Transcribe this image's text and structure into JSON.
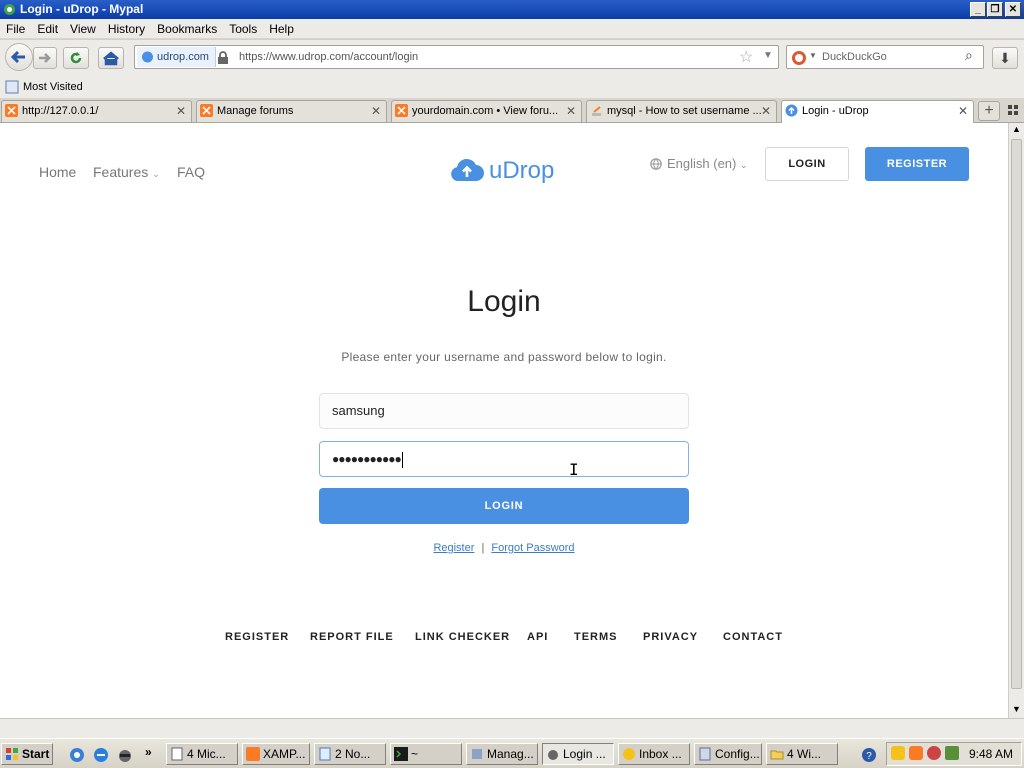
{
  "window": {
    "title": "Login - uDrop - Mypal"
  },
  "menu": [
    "File",
    "Edit",
    "View",
    "History",
    "Bookmarks",
    "Tools",
    "Help"
  ],
  "urlbar": {
    "site": "udrop.com",
    "url": "https://www.udrop.com/account/login"
  },
  "search": {
    "placeholder": "DuckDuckGo"
  },
  "bookmarks": {
    "most_visited": "Most Visited"
  },
  "tabs": [
    {
      "label": "http://127.0.0.1/"
    },
    {
      "label": "Manage forums"
    },
    {
      "label": "yourdomain.com • View foru..."
    },
    {
      "label": "mysql - How to set username ..."
    },
    {
      "label": "Login - uDrop"
    }
  ],
  "page": {
    "nav": {
      "home": "Home",
      "features": "Features",
      "faq": "FAQ"
    },
    "brand": "uDrop",
    "language": "English (en)",
    "header_login": "LOGIN",
    "header_register": "REGISTER",
    "heading": "Login",
    "intro": "Please enter your username and password below to login.",
    "username_value": "samsung",
    "password_value": "●●●●●●●●●●●",
    "login_button": "LOGIN",
    "register_link": "Register",
    "separator": "|",
    "forgot_link": "Forgot Password",
    "footer": [
      "REGISTER",
      "REPORT FILE",
      "LINK CHECKER",
      "API",
      "TERMS",
      "PRIVACY",
      "CONTACT"
    ]
  },
  "colors": {
    "accent": "#4a90e2",
    "link": "#3a7cc8"
  },
  "taskbar": {
    "start": "Start",
    "items": [
      "4 Mic...",
      "XAMP...",
      "2 No...",
      "~",
      "Manag...",
      "Login ...",
      "Inbox ...",
      "Config...",
      "4 Wi..."
    ],
    "clock": "9:48 AM"
  }
}
